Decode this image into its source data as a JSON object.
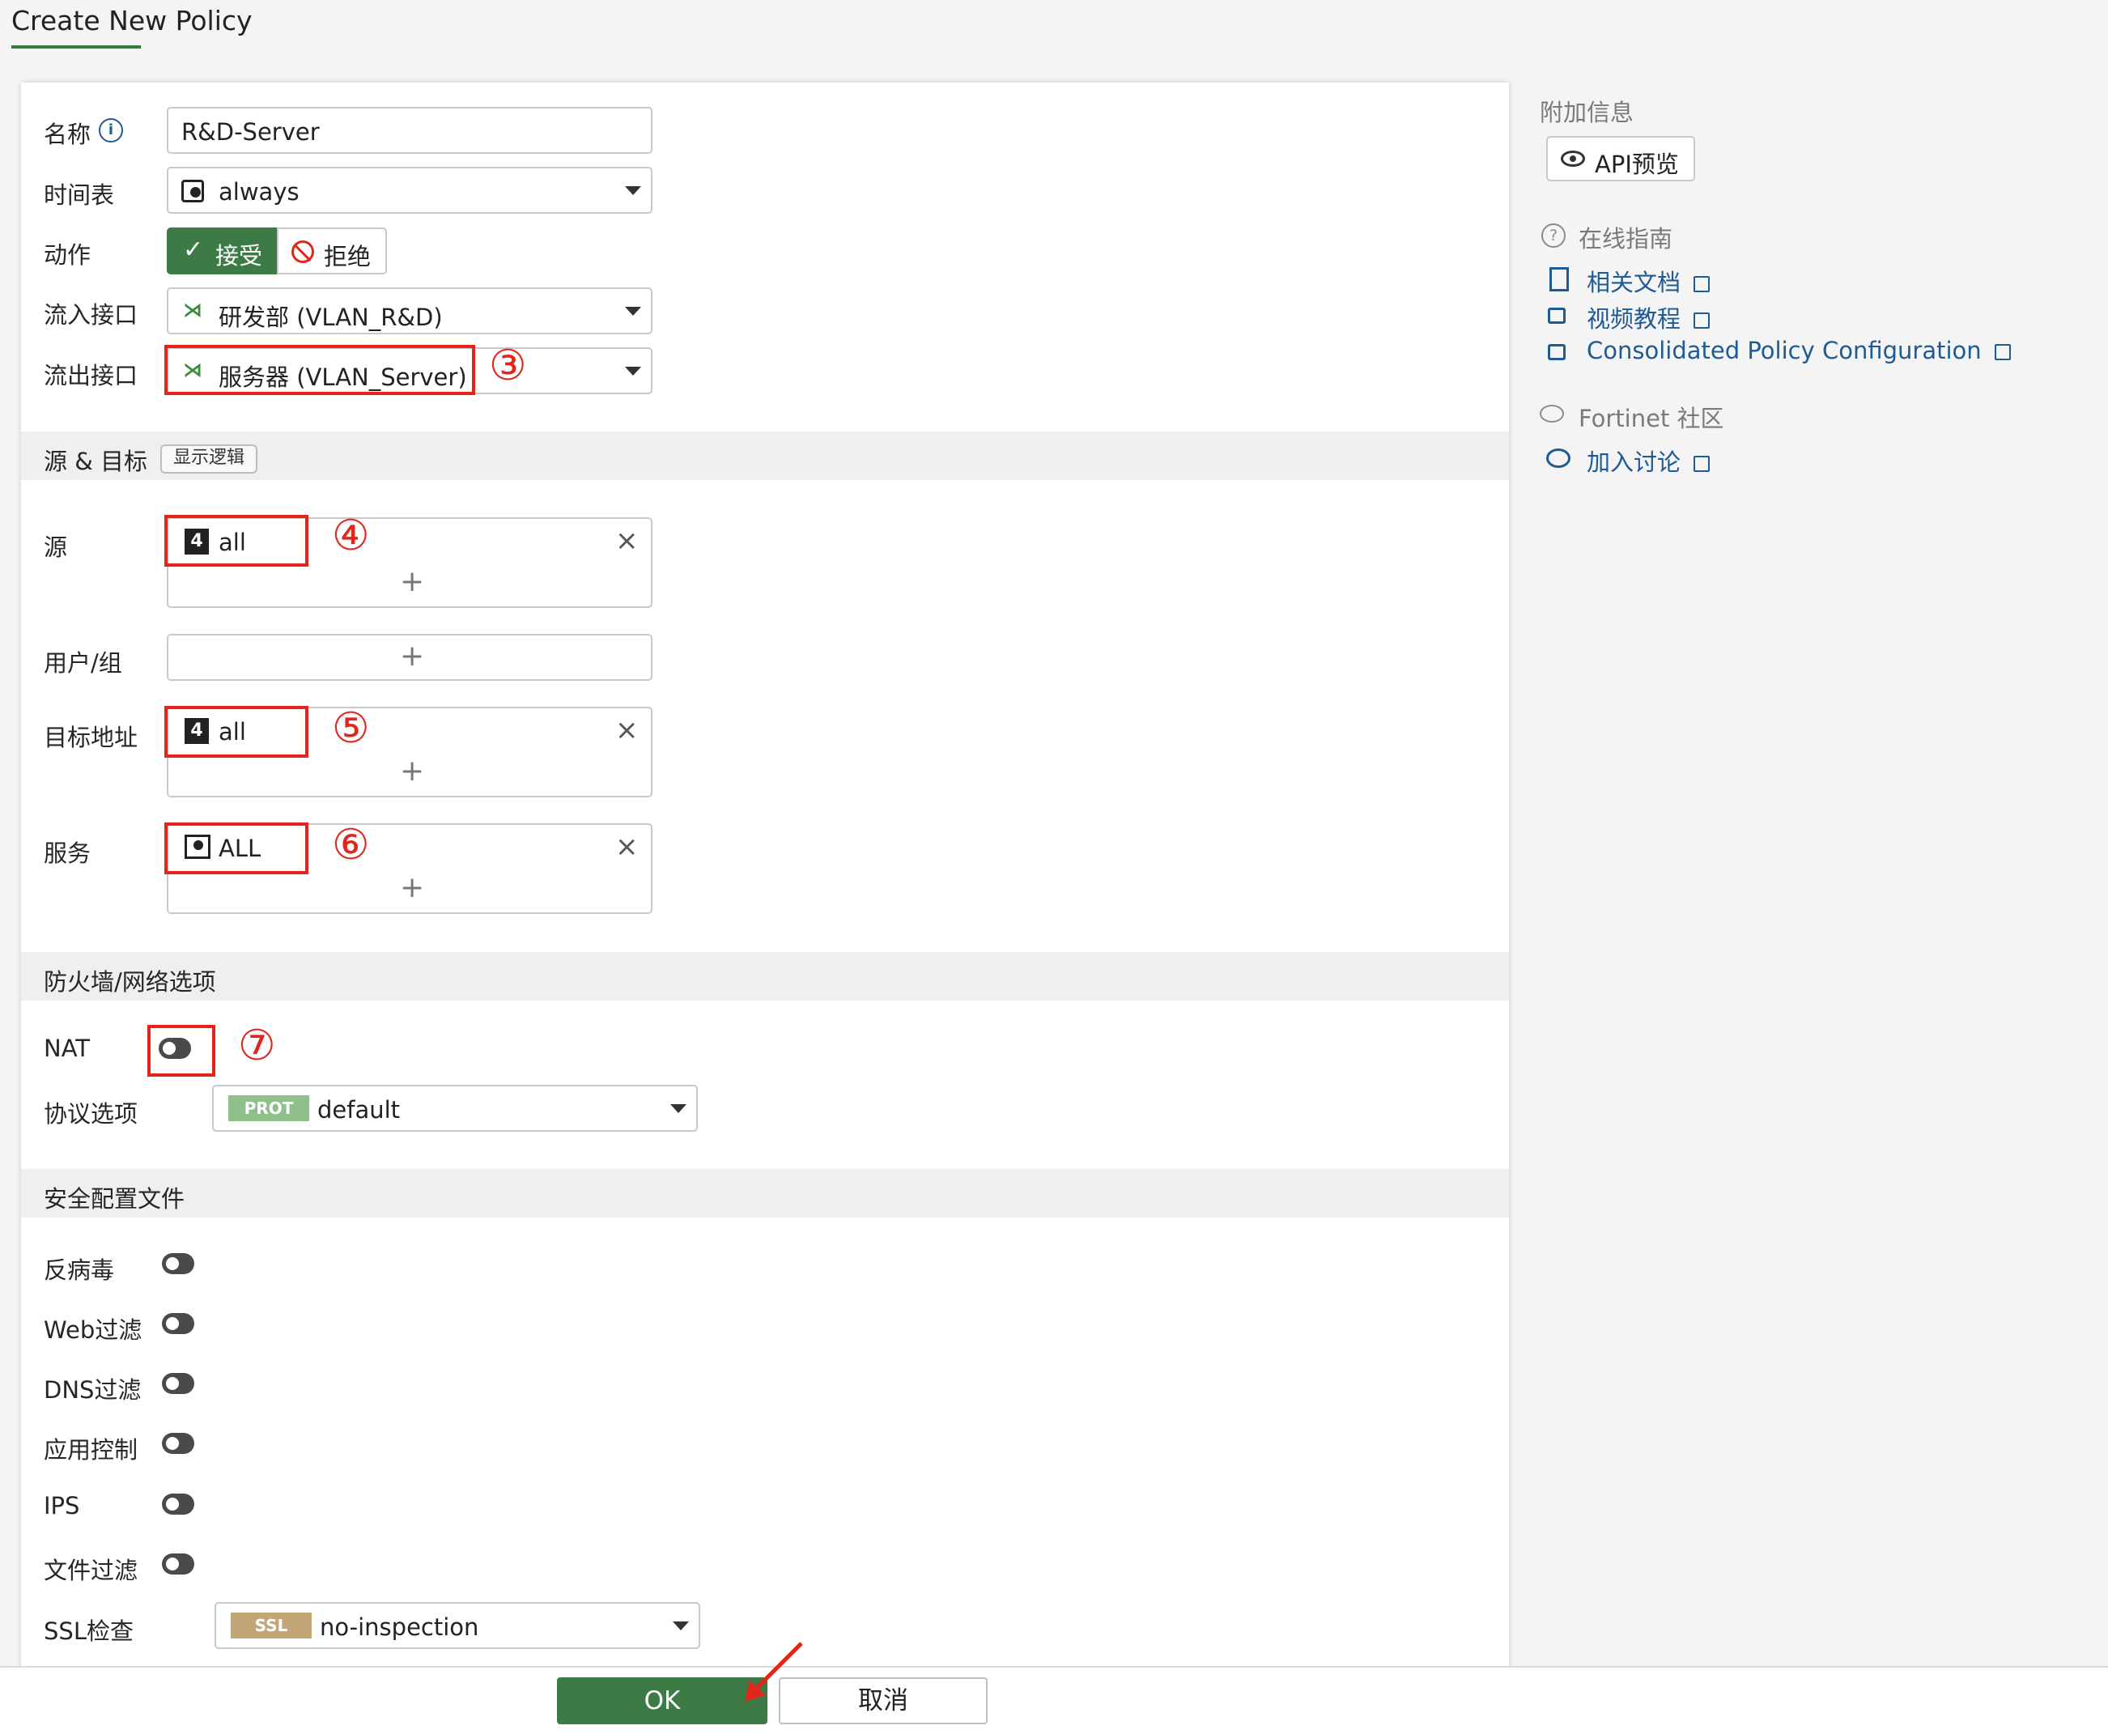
{
  "page": {
    "title": "Create New Policy"
  },
  "form": {
    "name": {
      "label": "名称",
      "value": "R&D-Server"
    },
    "schedule": {
      "label": "时间表",
      "value": "always"
    },
    "action": {
      "label": "动作",
      "accept": "接受",
      "deny": "拒绝",
      "selected": "accept"
    },
    "incoming": {
      "label": "流入接口",
      "value": "研发部 (VLAN_R&D)"
    },
    "outgoing": {
      "label": "流出接口",
      "value": "服务器 (VLAN_Server)",
      "marker": "③"
    },
    "source_section": {
      "title": "源 & 目标",
      "logic_button": "显示逻辑"
    },
    "source": {
      "label": "源",
      "value": "all",
      "marker": "④"
    },
    "user_group": {
      "label": "用户/组"
    },
    "destination": {
      "label": "目标地址",
      "value": "all",
      "marker": "⑤"
    },
    "service": {
      "label": "服务",
      "value": "ALL",
      "marker": "⑥"
    },
    "firewall_section": {
      "title": "防火墙/网络选项"
    },
    "nat": {
      "label": "NAT",
      "marker": "⑦",
      "enabled": false
    },
    "protocol": {
      "label": "协议选项",
      "tag": "PROT",
      "value": "default",
      "tag_color": "#8fbf8a"
    },
    "security_section": {
      "title": "安全配置文件"
    },
    "profiles": [
      {
        "label": "反病毒",
        "enabled": false
      },
      {
        "label": "Web过滤",
        "enabled": false
      },
      {
        "label": "DNS过滤",
        "enabled": false
      },
      {
        "label": "应用控制",
        "enabled": false
      },
      {
        "label": "IPS",
        "enabled": false
      },
      {
        "label": "文件过滤",
        "enabled": false
      }
    ],
    "ssl": {
      "label": "SSL检查",
      "tag": "SSL",
      "value": "no-inspection",
      "tag_color": "#c2a678"
    }
  },
  "sidebar": {
    "extra_info": "附加信息",
    "api_preview": "API预览",
    "online_guide": "在线指南",
    "links": [
      "相关文档",
      "视频教程",
      "Consolidated Policy Configuration"
    ],
    "community": "Fortinet 社区",
    "join": "加入讨论"
  },
  "footer": {
    "ok": "OK",
    "cancel": "取消"
  },
  "colors": {
    "accent": "#3c7b46",
    "link": "#1f5a94",
    "annotation": "#e3261b"
  }
}
